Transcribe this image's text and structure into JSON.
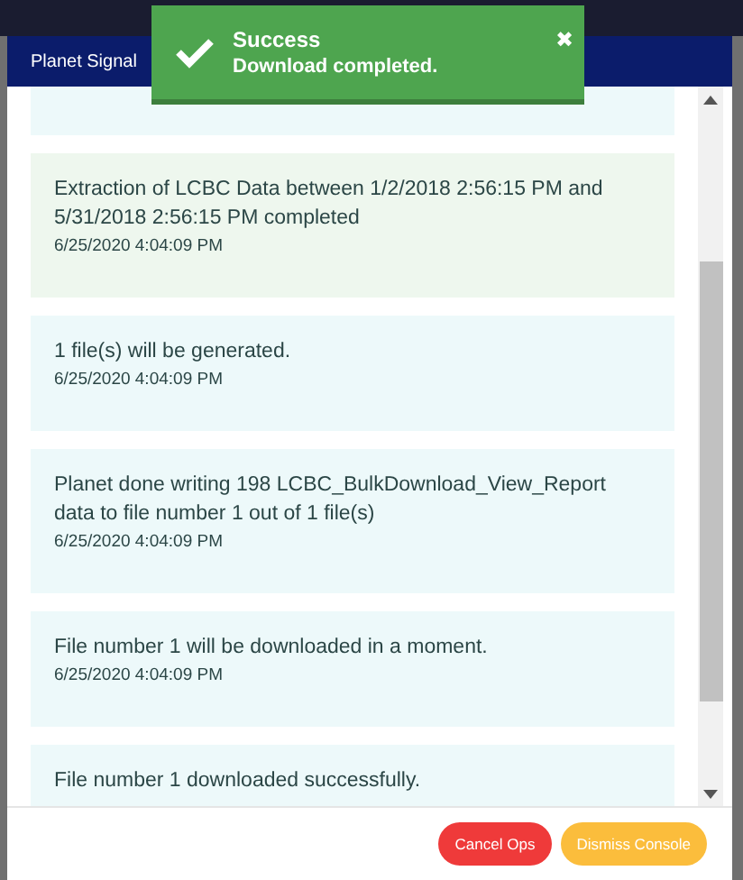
{
  "dialog": {
    "title": "Planet Signal"
  },
  "toast": {
    "title": "Success",
    "message": "Download completed.",
    "close": "✖"
  },
  "messages": [
    {
      "kind": "success",
      "text": "Extraction of LCBC Data between 1/2/2018 2:56:15 PM and 5/31/2018 2:56:15 PM completed",
      "time": "6/25/2020 4:04:09 PM"
    },
    {
      "kind": "info",
      "text": "1 file(s) will be generated.",
      "time": "6/25/2020 4:04:09 PM"
    },
    {
      "kind": "info",
      "text": "Planet done writing 198 LCBC_BulkDownload_View_Report data to file number 1 out of 1 file(s)",
      "time": "6/25/2020 4:04:09 PM"
    },
    {
      "kind": "info",
      "text": "File number 1 will be downloaded in a moment.",
      "time": "6/25/2020 4:04:09 PM"
    },
    {
      "kind": "info",
      "text": "File number 1 downloaded successfully."
    }
  ],
  "buttons": [
    {
      "kind": "danger",
      "label": "Cancel Ops"
    },
    {
      "kind": "warning",
      "label": "Dismiss Console"
    }
  ]
}
